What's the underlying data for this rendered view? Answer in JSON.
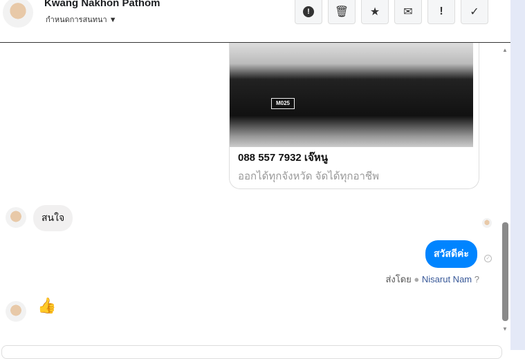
{
  "header": {
    "name": "Kwang Nakhon Pathom",
    "subtitle": "กำหนดการสนทนา"
  },
  "toolbar": [
    {
      "name": "spam-button",
      "icon": "!"
    },
    {
      "name": "delete-button",
      "icon": "🗑"
    },
    {
      "name": "star-button",
      "icon": "★"
    },
    {
      "name": "mark-unread-button",
      "icon": "✉"
    },
    {
      "name": "follow-up-button",
      "icon": "!"
    },
    {
      "name": "done-button",
      "icon": "✓"
    }
  ],
  "card": {
    "plate": "M025",
    "title": "088 557 7932 เจ๊หนู",
    "subtitle": "ออกได้ทุกจังหวัด จัดได้ทุกอาชีพ"
  },
  "messages": {
    "incoming": "สนใจ",
    "outgoing": "สวัสดีค่ะ",
    "sent_by_label": "ส่งโดย",
    "sender": "Nisarut Nam"
  },
  "colors": {
    "accent": "#0084ff"
  }
}
